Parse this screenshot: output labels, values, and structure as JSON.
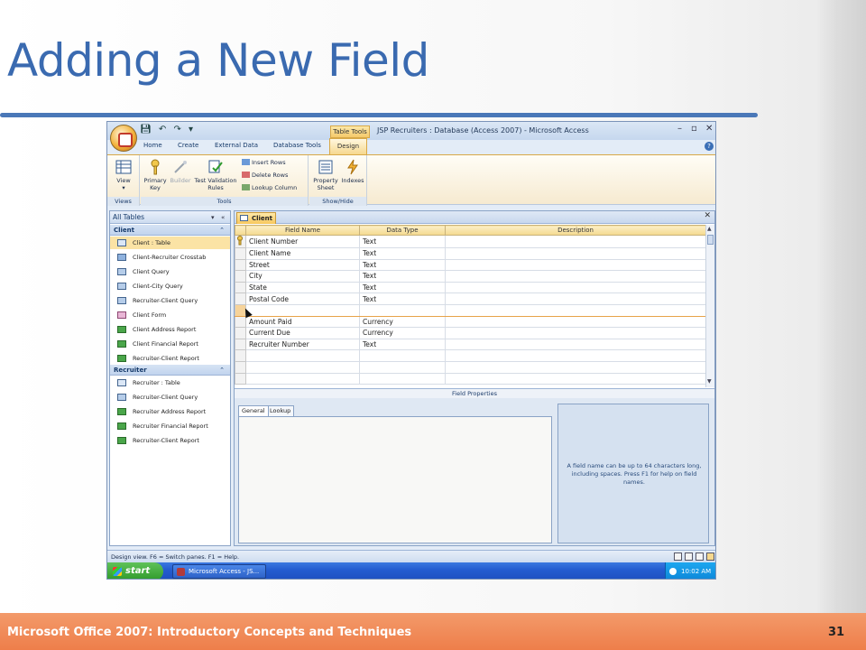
{
  "slide": {
    "title": "Adding a New Field",
    "footer_text": "Microsoft Office 2007: Introductory Concepts and Techniques",
    "page_number": "31",
    "colors": {
      "title": "#3a6ab0",
      "footer": "#ee7e4a"
    }
  },
  "window": {
    "context_tab": "Table Tools",
    "title": "JSP Recruiters : Database (Access 2007) - Microsoft Access",
    "tabs": [
      "Home",
      "Create",
      "External Data",
      "Database Tools"
    ],
    "active_tab": "Design"
  },
  "ribbon": {
    "groups": {
      "views": "Views",
      "tools": "Tools",
      "show_hide": "Show/Hide"
    },
    "buttons": {
      "view": "View",
      "primary_key": "Primary Key",
      "builder": "Builder",
      "test_validation_rules": "Test Validation Rules",
      "insert_rows": "Insert Rows",
      "delete_rows": "Delete Rows",
      "lookup_column": "Lookup Column",
      "property_sheet": "Property Sheet",
      "indexes": "Indexes"
    }
  },
  "nav": {
    "header": "All Tables",
    "groups": [
      {
        "name": "Client",
        "items": [
          {
            "label": "Client : Table",
            "type": "table",
            "selected": true
          },
          {
            "label": "Client-Recruiter Crosstab",
            "type": "crosstab"
          },
          {
            "label": "Client Query",
            "type": "query"
          },
          {
            "label": "Client-City Query",
            "type": "query"
          },
          {
            "label": "Recruiter-Client Query",
            "type": "query"
          },
          {
            "label": "Client Form",
            "type": "form"
          },
          {
            "label": "Client Address Report",
            "type": "report"
          },
          {
            "label": "Client Financial Report",
            "type": "report"
          },
          {
            "label": "Recruiter-Client Report",
            "type": "report"
          }
        ]
      },
      {
        "name": "Recruiter",
        "items": [
          {
            "label": "Recruiter : Table",
            "type": "table"
          },
          {
            "label": "Recruiter-Client Query",
            "type": "query"
          },
          {
            "label": "Recruiter Address Report",
            "type": "report"
          },
          {
            "label": "Recruiter Financial Report",
            "type": "report"
          },
          {
            "label": "Recruiter-Client Report",
            "type": "report"
          }
        ]
      }
    ]
  },
  "design": {
    "tab_label": "Client",
    "columns": [
      "Field Name",
      "Data Type",
      "Description"
    ],
    "rows": [
      {
        "field": "Client Number",
        "type": "Text",
        "primary_key": true
      },
      {
        "field": "Client Name",
        "type": "Text"
      },
      {
        "field": "Street",
        "type": "Text"
      },
      {
        "field": "City",
        "type": "Text"
      },
      {
        "field": "State",
        "type": "Text"
      },
      {
        "field": "Postal Code",
        "type": "Text"
      },
      {
        "field": "",
        "type": "",
        "new_row": true
      },
      {
        "field": "Amount Paid",
        "type": "Currency"
      },
      {
        "field": "Current Due",
        "type": "Currency"
      },
      {
        "field": "Recruiter Number",
        "type": "Text"
      },
      {
        "field": "",
        "type": ""
      },
      {
        "field": "",
        "type": ""
      },
      {
        "field": "",
        "type": ""
      }
    ],
    "field_properties_label": "Field Properties",
    "property_tabs": [
      "General",
      "Lookup"
    ],
    "help_text": "A field name can be up to 64 characters long, including spaces.  Press F1 for help on field names."
  },
  "status": {
    "text": "Design view.  F6 = Switch panes.  F1 = Help."
  },
  "taskbar": {
    "start": "start",
    "task": "Microsoft Access - JS...",
    "clock": "10:02 AM"
  }
}
